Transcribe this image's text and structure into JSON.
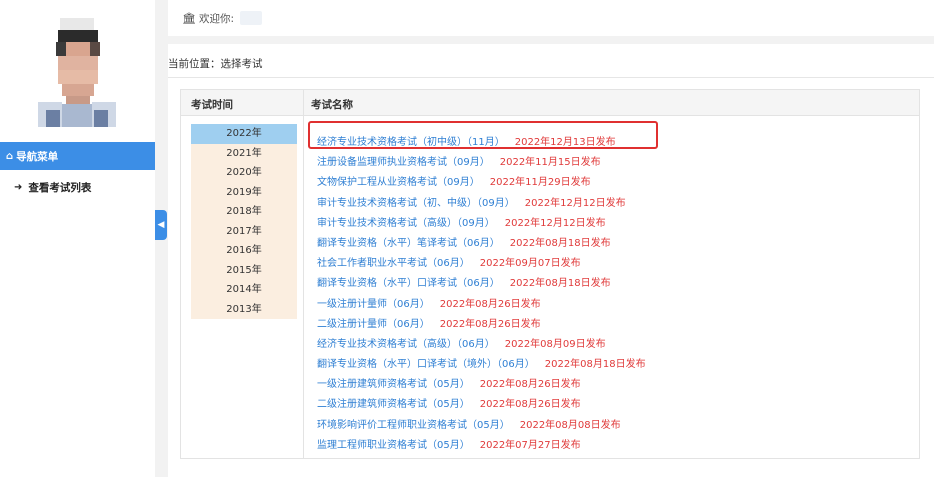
{
  "header": {
    "welcome_text": "欢迎你:"
  },
  "sidebar": {
    "nav_title": "导航菜单",
    "items": [
      {
        "label": "查看考试列表"
      }
    ]
  },
  "main": {
    "breadcrumb": "当前位置：选择考试",
    "table": {
      "col_time": "考试时间",
      "col_name": "考试名称"
    },
    "years": [
      {
        "label": "2022年",
        "active": true
      },
      {
        "label": "2021年"
      },
      {
        "label": "2020年"
      },
      {
        "label": "2019年"
      },
      {
        "label": "2018年"
      },
      {
        "label": "2017年"
      },
      {
        "label": "2016年"
      },
      {
        "label": "2015年"
      },
      {
        "label": "2014年"
      },
      {
        "label": "2013年"
      }
    ],
    "exams": [
      {
        "name": "经济专业技术资格考试（初中级）（11月）",
        "date": "2022年12月13日发布",
        "highlighted": true
      },
      {
        "name": "注册设备监理师执业资格考试（09月）",
        "date": "2022年11月15日发布"
      },
      {
        "name": "文物保护工程从业资格考试（09月）",
        "date": "2022年11月29日发布"
      },
      {
        "name": "审计专业技术资格考试（初、中级）（09月）",
        "date": "2022年12月12日发布"
      },
      {
        "name": "审计专业技术资格考试（高级）（09月）",
        "date": "2022年12月12日发布"
      },
      {
        "name": "翻译专业资格（水平）笔译考试（06月）",
        "date": "2022年08月18日发布"
      },
      {
        "name": "社会工作者职业水平考试（06月）",
        "date": "2022年09月07日发布"
      },
      {
        "name": "翻译专业资格（水平）口译考试（06月）",
        "date": "2022年08月18日发布"
      },
      {
        "name": "一级注册计量师（06月）",
        "date": "2022年08月26日发布"
      },
      {
        "name": "二级注册计量师（06月）",
        "date": "2022年08月26日发布"
      },
      {
        "name": "经济专业技术资格考试（高级）（06月）",
        "date": "2022年08月09日发布"
      },
      {
        "name": "翻译专业资格（水平）口译考试（境外）（06月）",
        "date": "2022年08月18日发布"
      },
      {
        "name": "一级注册建筑师资格考试（05月）",
        "date": "2022年08月26日发布"
      },
      {
        "name": "二级注册建筑师资格考试（05月）",
        "date": "2022年08月26日发布"
      },
      {
        "name": "环境影响评价工程师职业资格考试（05月）",
        "date": "2022年08月08日发布"
      },
      {
        "name": "监理工程师职业资格考试（05月）",
        "date": "2022年07月27日发布"
      }
    ]
  },
  "icons": {
    "welcome": "bank-icon",
    "nav_title": "home-icon",
    "nav_item": "sign-in-icon",
    "collapse": "chevron-left-icon"
  },
  "colors": {
    "accent": "#3c8ee6",
    "link": "#2f7fd3",
    "date": "#e03a3a",
    "year_bg": "#fbeee0",
    "year_active": "#9fcff0",
    "highlight_border": "#e03030"
  }
}
